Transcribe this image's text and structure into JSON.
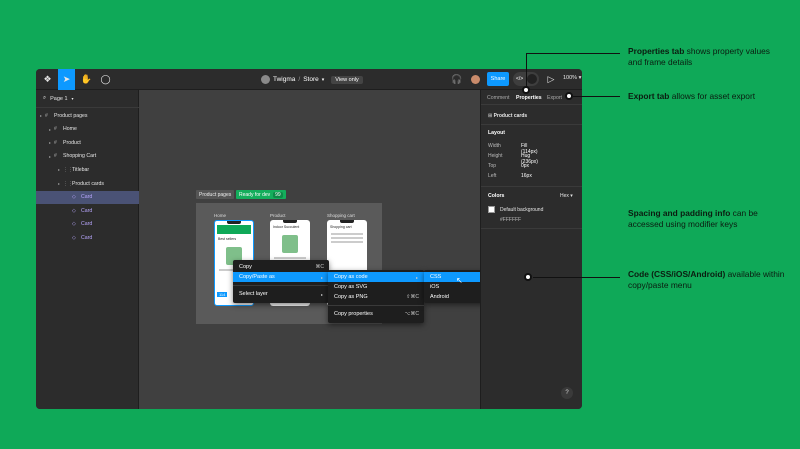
{
  "toolbar": {
    "project": "Twigma",
    "separator": "/",
    "file": "Store",
    "view_mode": "View only",
    "share": "Share",
    "dev_mode": "</>",
    "zoom": "100%"
  },
  "left_panel": {
    "page": "Page 1",
    "layers": [
      {
        "label": "Product pages",
        "depth": 0
      },
      {
        "label": "Home",
        "depth": 1
      },
      {
        "label": "Product",
        "depth": 1
      },
      {
        "label": "Shopping Cart",
        "depth": 1
      },
      {
        "label": "Titlebar",
        "depth": 2
      },
      {
        "label": "Product cards",
        "depth": 2
      },
      {
        "label": "Card",
        "depth": 3,
        "selected": true
      },
      {
        "label": "Card",
        "depth": 3
      },
      {
        "label": "Card",
        "depth": 3
      },
      {
        "label": "Card",
        "depth": 3
      }
    ]
  },
  "canvas": {
    "tag_pages": "Product pages",
    "tag_ready": "Ready for dev",
    "tag_ready_count": "99",
    "phones": [
      {
        "label": "Home",
        "title": "Best sellers"
      },
      {
        "label": "Product",
        "title": "Indoor Succulent"
      },
      {
        "label": "Shopping cart",
        "title": "Shopping cart"
      }
    ],
    "home_badge": "114"
  },
  "context_menu": {
    "items": [
      {
        "label": "Copy",
        "shortcut": "⌘C"
      },
      {
        "label": "Copy/Paste as",
        "arrow": "▸"
      },
      {
        "label": "Select layer",
        "arrow": "▸"
      }
    ],
    "submenu": [
      {
        "label": "Copy as code",
        "arrow": "▸"
      },
      {
        "label": "Copy as SVG",
        "shortcut": ""
      },
      {
        "label": "Copy as PNG",
        "shortcut": "⇧⌘C"
      },
      {
        "label": "Copy properties",
        "shortcut": "⌥⌘C"
      }
    ],
    "code_menu": [
      "CSS",
      "iOS",
      "Android"
    ]
  },
  "right_panel": {
    "tabs": [
      "Comment",
      "Properties",
      "Export"
    ],
    "selection": "Product cards",
    "layout_title": "Layout",
    "layout": [
      {
        "label": "Width",
        "value": "Fill (114px)"
      },
      {
        "label": "Height",
        "value": "Hug (236px)"
      },
      {
        "label": "Top",
        "value": "0px"
      },
      {
        "label": "Left",
        "value": "16px"
      }
    ],
    "colors_title": "Colors",
    "color_format": "Hex",
    "color_name": "Default background",
    "color_hex": "#FFFFFF",
    "help": "?"
  },
  "annotations": [
    {
      "bold": "Properties tab",
      "rest": " shows property values and frame details"
    },
    {
      "bold": "Export tab",
      "rest": " allows for asset export"
    },
    {
      "bold": "Spacing and padding info",
      "rest": " can be accessed using modifier keys"
    },
    {
      "bold": "Code (CSS/iOS/Android)",
      "rest": " available within copy/paste menu"
    }
  ],
  "colors": {
    "background": "#0fa958",
    "accent": "#0d99ff",
    "ready": "#14ae5c"
  }
}
